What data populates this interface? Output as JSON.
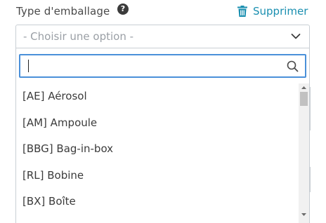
{
  "field": {
    "label": "Type d'emballage",
    "help_glyph": "?",
    "help_icon": "question-circle-icon",
    "delete_label": "Supprimer",
    "delete_icon": "trash-icon",
    "accent_color": "#1a8fb0"
  },
  "select": {
    "placeholder": "- Choisir une option -",
    "chevron_icon": "chevron-down-icon"
  },
  "search": {
    "value": "",
    "icon": "search-icon",
    "focus_color": "#4a90d9"
  },
  "options": [
    "[AE] Aérosol",
    "[AM] Ampoule",
    "[BBG] Bag-in-box",
    "[RL] Bobine",
    "[BX] Boîte"
  ]
}
